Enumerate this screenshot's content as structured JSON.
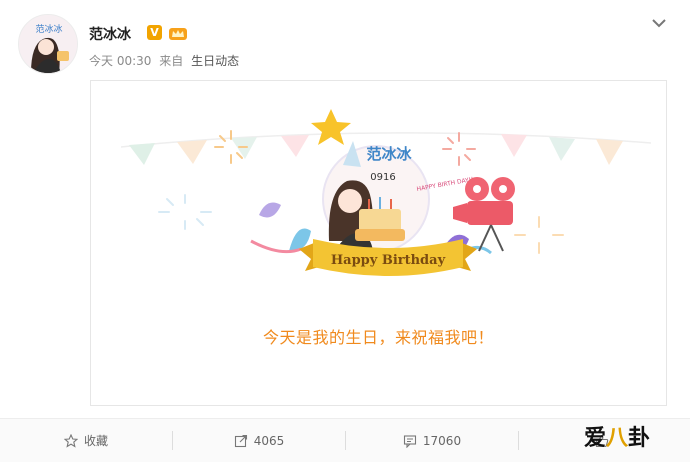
{
  "header": {
    "avatar_text": "范冰冰",
    "username": "范冰冰",
    "vip_badge": "V",
    "time": "今天 00:30",
    "source_prefix": "来自",
    "source": "生日动态"
  },
  "card": {
    "badge_title": "范冰冰",
    "badge_date": "0916",
    "cake_sign": "HAPPY BIRTH DAY!!",
    "banner": "Happy Birthday",
    "message": "今天是我的生日，来祝福我吧！"
  },
  "actions": [
    {
      "icon": "star-icon",
      "label": "收藏"
    },
    {
      "icon": "share-icon",
      "label": "4065"
    },
    {
      "icon": "comment-icon",
      "label": "17060"
    },
    {
      "icon": "thumb-up-icon",
      "label": ""
    }
  ],
  "watermark": {
    "part1": "爱",
    "part2": "八",
    "part3": "卦"
  },
  "colors": {
    "accent_orange": "#f08a1d",
    "vip": "#f2a400",
    "ribbon": "#f3c433"
  }
}
